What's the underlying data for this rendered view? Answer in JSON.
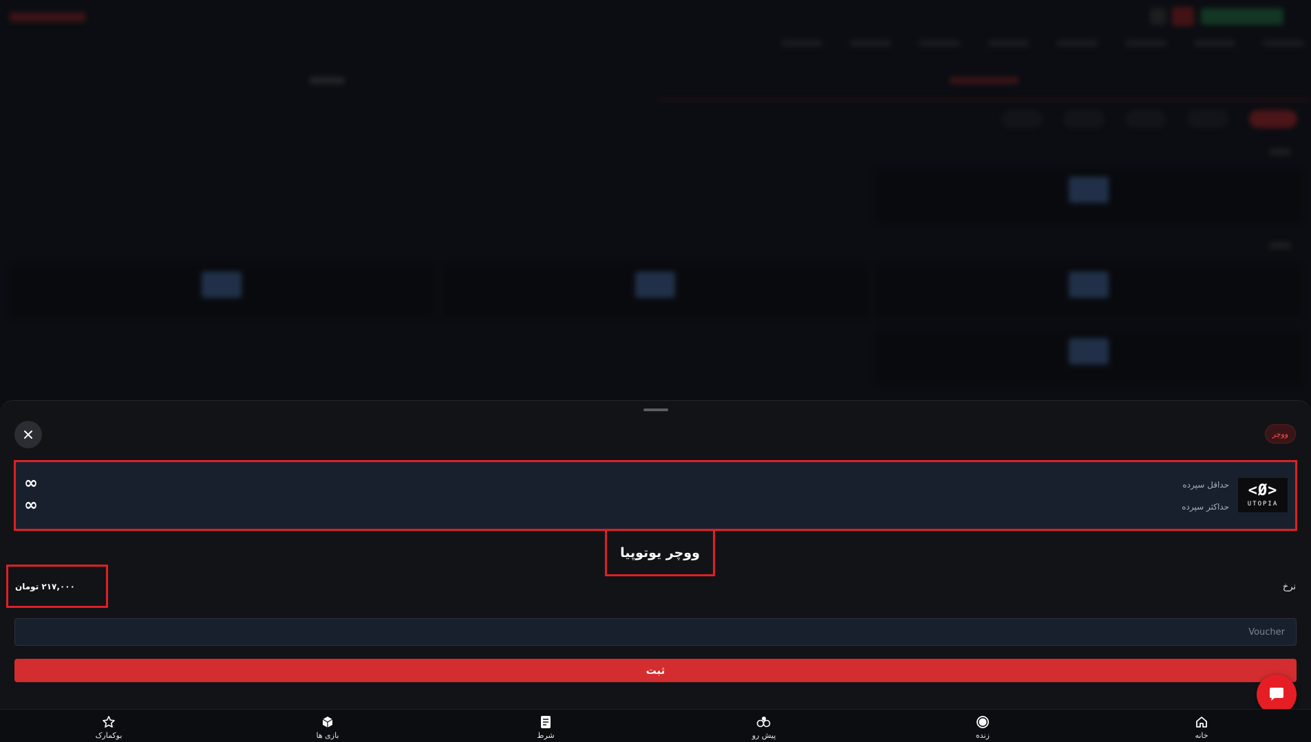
{
  "sheet": {
    "badge_label": "ووچر",
    "close_icon": "close-icon",
    "info": {
      "min_deposit_label": "حداقل سپرده",
      "min_deposit_value": "∞",
      "max_deposit_label": "حداکثر سپرده",
      "max_deposit_value": "∞",
      "logo_mark": "<Ø>",
      "logo_word": "UTOPIA"
    },
    "title": "ووچر یوتوپیا",
    "rate_label": "نرخ",
    "rate_value": "۲۱۷,۰۰۰ تومان",
    "voucher_placeholder": "Voucher",
    "submit_label": "ثبت"
  },
  "bottom_nav": {
    "items": [
      {
        "label": "خانه",
        "icon": "home-icon"
      },
      {
        "label": "زنده",
        "icon": "live-icon"
      },
      {
        "label": "پیش رو",
        "icon": "soccer-icon"
      },
      {
        "label": "شرط",
        "icon": "bet-slip-icon"
      },
      {
        "label": "بازی ها",
        "icon": "dice-icon"
      },
      {
        "label": "بوکمارک",
        "icon": "star-icon"
      }
    ]
  },
  "colors": {
    "accent": "#d32d2f",
    "highlight_border": "#e01f26",
    "panel": "#18202d",
    "sheet_bg": "#121316"
  }
}
